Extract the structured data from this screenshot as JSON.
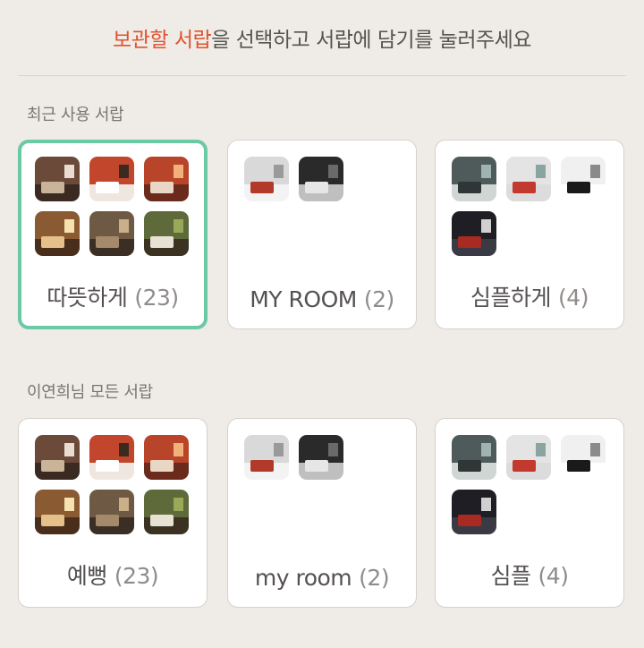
{
  "header": {
    "highlight": "보관할 서랍",
    "rest": "을 선택하고 서랍에 담기를 눌러주세요"
  },
  "recent": {
    "label": "최근 사용 서랍",
    "drawers": [
      {
        "name": "따뜻하게",
        "count": "(23)",
        "selected": true,
        "thumbs": [
          {
            "wall": "#6b4a3a",
            "floor": "#3a2a22",
            "furn": "#c9b49a",
            "accent": "#e8ddd0"
          },
          {
            "wall": "#c2462c",
            "floor": "#efe7df",
            "furn": "#ffffff",
            "accent": "#3a2a20"
          },
          {
            "wall": "#b8442a",
            "floor": "#6a2a1c",
            "furn": "#e9d6c4",
            "accent": "#f0b27a"
          },
          {
            "wall": "#8a5a32",
            "floor": "#4a2e1c",
            "furn": "#e6c08a",
            "accent": "#f6e2b0"
          },
          {
            "wall": "#6e5a44",
            "floor": "#3b2f25",
            "furn": "#a48a6a",
            "accent": "#c9b08a"
          },
          {
            "wall": "#5f6a3a",
            "floor": "#3b3222",
            "furn": "#e8e2d4",
            "accent": "#9aa85a"
          }
        ]
      },
      {
        "name": "MY ROOM",
        "count": "(2)",
        "selected": false,
        "thumbs": [
          {
            "wall": "#d9d9d9",
            "floor": "#f3f3f3",
            "furn": "#b23a2a",
            "accent": "#9a9a9a"
          },
          {
            "wall": "#2a2a2a",
            "floor": "#bfbfbf",
            "furn": "#e6e6e6",
            "accent": "#6a6a6a"
          }
        ]
      },
      {
        "name": "심플하게",
        "count": "(4)",
        "selected": false,
        "thumbs": [
          {
            "wall": "#4f5a5a",
            "floor": "#cfd6d4",
            "furn": "#2e3636",
            "accent": "#9fb3b0"
          },
          {
            "wall": "#e4e4e4",
            "floor": "#dcdcdc",
            "furn": "#c23a2e",
            "accent": "#8aa5a0"
          },
          {
            "wall": "#f0f0f0",
            "floor": "#ffffff",
            "furn": "#1a1a1a",
            "accent": "#8a8a8a"
          },
          {
            "wall": "#1e1e24",
            "floor": "#3a3a44",
            "furn": "#a82a22",
            "accent": "#d0d0d0"
          }
        ]
      }
    ]
  },
  "all": {
    "label": "이연희님 모든 서랍",
    "drawers": [
      {
        "name": "예뻥",
        "count": "(23)",
        "selected": false,
        "thumbs": [
          {
            "wall": "#6b4a3a",
            "floor": "#3a2a22",
            "furn": "#c9b49a",
            "accent": "#e8ddd0"
          },
          {
            "wall": "#c2462c",
            "floor": "#efe7df",
            "furn": "#ffffff",
            "accent": "#3a2a20"
          },
          {
            "wall": "#b8442a",
            "floor": "#6a2a1c",
            "furn": "#e9d6c4",
            "accent": "#f0b27a"
          },
          {
            "wall": "#8a5a32",
            "floor": "#4a2e1c",
            "furn": "#e6c08a",
            "accent": "#f6e2b0"
          },
          {
            "wall": "#6e5a44",
            "floor": "#3b2f25",
            "furn": "#a48a6a",
            "accent": "#c9b08a"
          },
          {
            "wall": "#5f6a3a",
            "floor": "#3b3222",
            "furn": "#e8e2d4",
            "accent": "#9aa85a"
          }
        ]
      },
      {
        "name": "my room",
        "count": "(2)",
        "selected": false,
        "thumbs": [
          {
            "wall": "#d9d9d9",
            "floor": "#f3f3f3",
            "furn": "#b23a2a",
            "accent": "#9a9a9a"
          },
          {
            "wall": "#2a2a2a",
            "floor": "#bfbfbf",
            "furn": "#e6e6e6",
            "accent": "#6a6a6a"
          }
        ]
      },
      {
        "name": "심플",
        "count": "(4)",
        "selected": false,
        "thumbs": [
          {
            "wall": "#4f5a5a",
            "floor": "#cfd6d4",
            "furn": "#2e3636",
            "accent": "#9fb3b0"
          },
          {
            "wall": "#e4e4e4",
            "floor": "#dcdcdc",
            "furn": "#c23a2e",
            "accent": "#8aa5a0"
          },
          {
            "wall": "#f0f0f0",
            "floor": "#ffffff",
            "furn": "#1a1a1a",
            "accent": "#8a8a8a"
          },
          {
            "wall": "#1e1e24",
            "floor": "#3a3a44",
            "furn": "#a82a22",
            "accent": "#d0d0d0"
          }
        ]
      }
    ]
  }
}
